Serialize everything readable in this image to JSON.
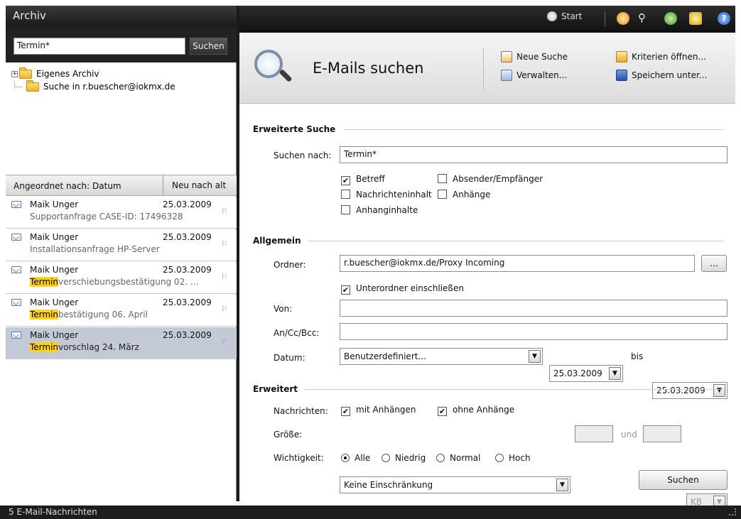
{
  "left": {
    "title": "Archiv",
    "search_value": "Termin*",
    "search_button": "Suchen",
    "tree": [
      {
        "label": "Eigenes Archiv"
      },
      {
        "label": "Suche in r.buescher@iokmx.de"
      }
    ],
    "sort_label": "Angeordnet nach: Datum",
    "sort_order": "Neu nach alt",
    "mails": [
      {
        "from": "Maik Unger",
        "date": "25.03.2009",
        "highlight": "",
        "subject": "Supportanfrage CASE-ID: 17496328"
      },
      {
        "from": "Maik Unger",
        "date": "25.03.2009",
        "highlight": "",
        "subject": "Installationsanfrage HP-Server"
      },
      {
        "from": "Maik Unger",
        "date": "25.03.2009",
        "highlight": "Termin",
        "subject": "verschiebungsbestätigung 02. ..."
      },
      {
        "from": "Maik Unger",
        "date": "25.03.2009",
        "highlight": "Termin",
        "subject": "bestätigung 06. April"
      },
      {
        "from": "Maik Unger",
        "date": "25.03.2009",
        "highlight": "Termin",
        "subject": "vorschlag 24. März"
      }
    ]
  },
  "status": "5 E-Mail-Nachrichten",
  "topbar": {
    "start": "Start"
  },
  "header": {
    "title": "E-Mails suchen",
    "new_search": "Neue Suche",
    "manage": "Verwalten...",
    "open_criteria": "Kriterien öffnen...",
    "save_as": "Speichern unter..."
  },
  "advanced": {
    "title": "Erweiterte Suche",
    "search_for_label": "Suchen nach:",
    "search_for_value": "Termin*",
    "opt_subject": "Betreff",
    "opt_sender": "Absender/Empfänger",
    "opt_content": "Nachrichteninhalt",
    "opt_attachments": "Anhänge",
    "opt_attach_content": "Anhanginhalte",
    "check": "✔"
  },
  "general": {
    "title": "Allgemein",
    "folder_label": "Ordner:",
    "folder_value": "r.buescher@iokmx.de/Proxy Incoming",
    "browse": "...",
    "subfolders": "Unterordner einschließen",
    "from_label": "Von:",
    "to_label": "An/Cc/Bcc:",
    "date_label": "Datum:",
    "date_mode": "Benutzerdefiniert...",
    "date_from": "25.03.2009",
    "bis": "bis",
    "date_to": "25.03.2009"
  },
  "extended": {
    "title": "Erweitert",
    "messages_label": "Nachrichten:",
    "with_attach": "mit Anhängen",
    "without_attach": "ohne Anhänge",
    "size_label": "Größe:",
    "size_value": "Keine Einschränkung",
    "und": "und",
    "unit": "KB",
    "importance_label": "Wichtigkeit:",
    "imp_all": "Alle",
    "imp_low": "Niedrig",
    "imp_normal": "Normal",
    "imp_high": "Hoch",
    "submit": "Suchen"
  }
}
